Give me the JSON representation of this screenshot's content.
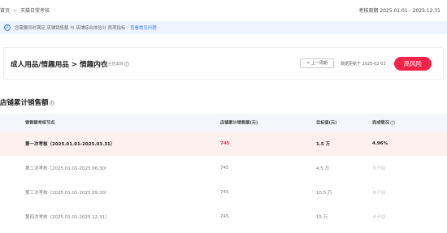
{
  "breadcrumb": {
    "home": "首页",
    "separator": ">",
    "current": "天猫日常考核"
  },
  "period": "考核周期 2025.01.01 - 2025.12.31",
  "notice": {
    "icon": "info-icon",
    "text": "您需要同时满足 店铺销售额 与 店铺综合体验分 两项指标",
    "link": "查看常见问题"
  },
  "category": {
    "title": "成人用品/情趣用品 > 情趣内衣",
    "subtitle": "考核主营类目",
    "prev_label": "< 上一周期",
    "update_text": "数据更新于 2025-02-03",
    "risk_label": "高风险",
    "risk_color": "#f0244b"
  },
  "section": {
    "title": "店铺累计销售额"
  },
  "table": {
    "headers": [
      "销售额考核节点",
      "店铺累计销售额(元)",
      "目标值(元)",
      "完成情况"
    ],
    "rows": [
      {
        "node": "第一次考核（2025.01.01-2025.03.31）",
        "sales": "745",
        "target": "1.5 万",
        "status": "4.96%"
      },
      {
        "node": "第二次考核（2025.01.01-2025.06.30）",
        "sales": "745",
        "target": "4.5 万",
        "status": "未开始"
      },
      {
        "node": "第三次考核（2025.01.01-2025.09.30）",
        "sales": "745",
        "target": "10.5 万",
        "status": "未开始"
      },
      {
        "node": "第四次考核（2025.01.01-2025.12.31）",
        "sales": "745",
        "target": "15 万",
        "status": "未开始"
      }
    ]
  }
}
